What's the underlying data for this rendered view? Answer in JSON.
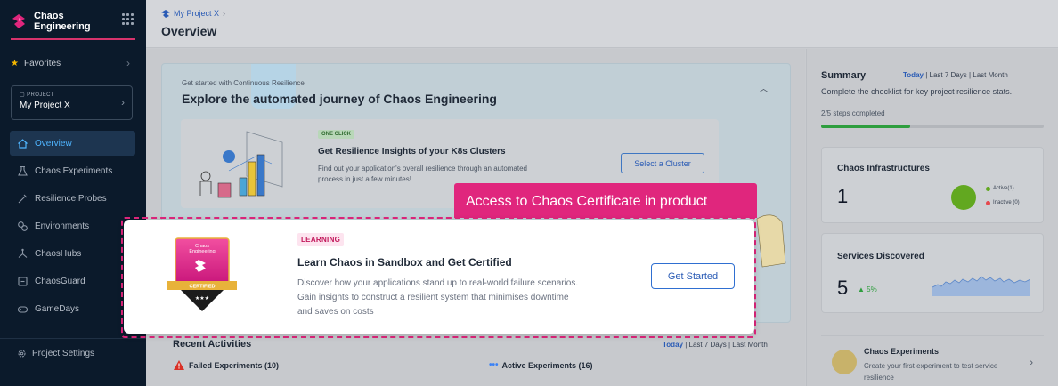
{
  "sidebar": {
    "brand_line1": "Chaos",
    "brand_line2": "Engineering",
    "favorites_label": "Favorites",
    "project_label": "PROJECT",
    "project_name": "My Project X",
    "items": [
      {
        "label": "Overview",
        "icon": "home-icon",
        "active": true
      },
      {
        "label": "Chaos Experiments",
        "icon": "flask-icon",
        "active": false
      },
      {
        "label": "Resilience Probes",
        "icon": "probe-icon",
        "active": false
      },
      {
        "label": "Environments",
        "icon": "environments-icon",
        "active": false
      },
      {
        "label": "ChaosHubs",
        "icon": "hub-icon",
        "active": false
      },
      {
        "label": "ChaosGuard",
        "icon": "guard-icon",
        "active": false
      },
      {
        "label": "GameDays",
        "icon": "gamepad-icon",
        "active": false
      }
    ],
    "settings_label": "Project Settings"
  },
  "header": {
    "breadcrumb": "My Project X",
    "title": "Overview"
  },
  "journey": {
    "small_title": "Get started with Continuous Resilience",
    "big_title": "Explore the automated journey of Chaos Engineering",
    "card": {
      "tag": "ONE CLICK",
      "title": "Get Resilience Insights of your K8s Clusters",
      "description": "Find out your application's overall resilience through an automated process in just a few minutes!",
      "button": "Select a Cluster"
    }
  },
  "recent": {
    "title": "Recent Activities",
    "range_selected": "Today",
    "range_rest": " | Last 7 Days | Last Month",
    "failed": "Failed Experiments (10)",
    "active": "Active Experiments (16)"
  },
  "summary": {
    "title": "Summary",
    "range_selected": "Today",
    "range_rest": " | Last 7 Days | Last Month",
    "subtitle": "Complete the checklist for key project resilience stats.",
    "steps_text": "2/5 steps completed",
    "steps_done": 2,
    "steps_total": 5,
    "infra": {
      "title": "Chaos Infrastructures",
      "count": "1",
      "legend_active": "Active(1)",
      "legend_inactive": "Inactive (0)"
    },
    "services": {
      "title": "Services Discovered",
      "count": "5",
      "trend": "5%"
    },
    "experiments": {
      "title": "Chaos Experiments",
      "description": "Create your first experiment to test service resilience"
    }
  },
  "highlight": {
    "tooltip": "Access to Chaos Certificate in product",
    "badge_line1": "Chaos",
    "badge_line2": "Engineering",
    "badge_ribbon": "CERTIFIED",
    "tag": "LEARNING",
    "title": "Learn Chaos in Sandbox and Get Certified",
    "description": "Discover how your applications stand up to real-world failure scenarios. Gain insights to construct a resilient system that minimises downtime and saves on costs",
    "button": "Get Started"
  },
  "colors": {
    "accent_pink": "#e0267d",
    "sidebar_bg": "#0b1a2b",
    "link_blue": "#2a5bb5",
    "success_green": "#2e9e3e",
    "inactive_red": "#e5484d"
  }
}
